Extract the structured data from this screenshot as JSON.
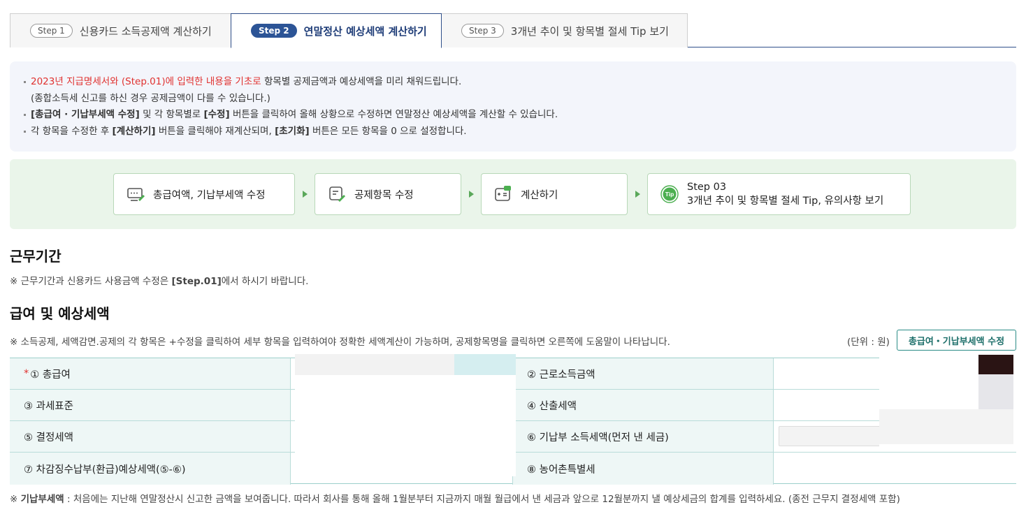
{
  "tabs": [
    {
      "step": "Step 1",
      "label": "신용카드 소득공제액 계산하기"
    },
    {
      "step": "Step 2",
      "label": "연말정산 예상세액 계산하기"
    },
    {
      "step": "Step 3",
      "label": "3개년 추이 및 항목별 절세 Tip 보기"
    }
  ],
  "info": {
    "line1_red": "2023년 지급명세서와 (Step.01)에 입력한 내용을 기초로",
    "line1_rest": " 항목별 공제금액과 예상세액을 미리 채워드립니다.",
    "line2": "(종합소득세 신고를 하신 경우 공제금액이 다를 수 있습니다.)",
    "line3_b1": "[총급여 · 기납부세액 수정]",
    "line3_m1": " 및 각 항목별로 ",
    "line3_b2": "[수정]",
    "line3_rest": " 버튼을 클릭하여 올해 상황으로 수정하면 연말정산 예상세액을 계산할 수 있습니다.",
    "line4_a": "각 항목을 수정한 후 ",
    "line4_b1": "[계산하기]",
    "line4_m": " 버튼을 클릭해야 재계산되며, ",
    "line4_b2": "[초기화]",
    "line4_rest": " 버튼은 모든 항목을 0 으로 설정합니다."
  },
  "flow": {
    "box1": "총급여액, 기납부세액 수정",
    "box2": "공제항목 수정",
    "box3": "계산하기",
    "box4_line1": "Step 03",
    "box4_line2": "3개년 추이 및 항목별 절세 Tip, 유의사항 보기",
    "tip_icon_text": "Tip"
  },
  "section_work": {
    "title": "근무기간",
    "note_a": "※ 근무기간과 신용카드 사용금액 수정은 ",
    "note_b": "[Step.01]",
    "note_c": "에서 하시기 바랍니다."
  },
  "section_pay": {
    "title": "급여 및 예상세액",
    "note": "※ 소득공제, 세액감면.공제의 각 항목은 +수정을 클릭하여 세부 항목을 입력하여야 정확한 세액계산이 가능하며, 공제항목명을 클릭하면 오른쪽에 도움말이 나타납니다.",
    "unit": "(단위 : 원)",
    "edit_button": "총급여・기납부세액 수정"
  },
  "table": {
    "rows": [
      {
        "left": "① 총급여",
        "required": "*",
        "right": "② 근로소득금액"
      },
      {
        "left": "③ 과세표준",
        "right": "④ 산출세액"
      },
      {
        "left": "⑤ 결정세액",
        "right": "⑥ 기납부 소득세액(먼저 낸 세금)"
      },
      {
        "left": "⑦ 차감징수납부(환급)예상세액(⑤-⑥)",
        "right": "⑧ 농어촌특별세"
      }
    ]
  },
  "footnote": {
    "a": "※ ",
    "b": "기납부세액",
    "c": " : 처음에는 지난해 연말정산시 신고한 금액을 보여줍니다. 따라서 회사를 통해 올해 1월분부터 지금까지 매월 월급에서 낸 세금과 앞으로 12월분까지 낼 예상세금의 합계를 입력하세요. (종전 근무지 결정세액 포함)"
  }
}
